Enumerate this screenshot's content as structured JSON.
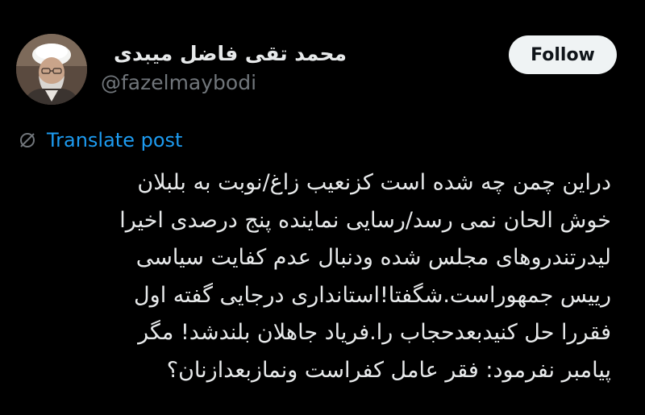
{
  "author": {
    "display_name": "محمد تقی فاضل میبدی",
    "handle": "@fazelmaybodi"
  },
  "actions": {
    "follow_label": "Follow"
  },
  "translate": {
    "label": "Translate post",
    "icon": "translate-slash-icon"
  },
  "post": {
    "lines": [
      "دراین چمن چه شده است کزنعیب زاغ/نوبت به بلبلان",
      "خوش الحان نمی رسد/رسایی نماینده پنج درصدی اخیرا",
      "لیدرتندروهای مجلس شده ودنبال عدم کفایت سیاسی",
      "رییس جمهوراست.شگفتا!استانداری درجایی گفته اول",
      "فقررا حل کنیدبعدحجاب را.فریاد جاهلان بلندشد! مگر",
      "پیامبر نفرمود: فقر عامل کفراست ونمازبعدازنان؟"
    ]
  },
  "colors": {
    "background": "#000000",
    "text": "#e7e9ea",
    "muted": "#71767b",
    "link": "#1d9bf0",
    "button_bg": "#eff3f4",
    "button_text": "#0f1419"
  }
}
